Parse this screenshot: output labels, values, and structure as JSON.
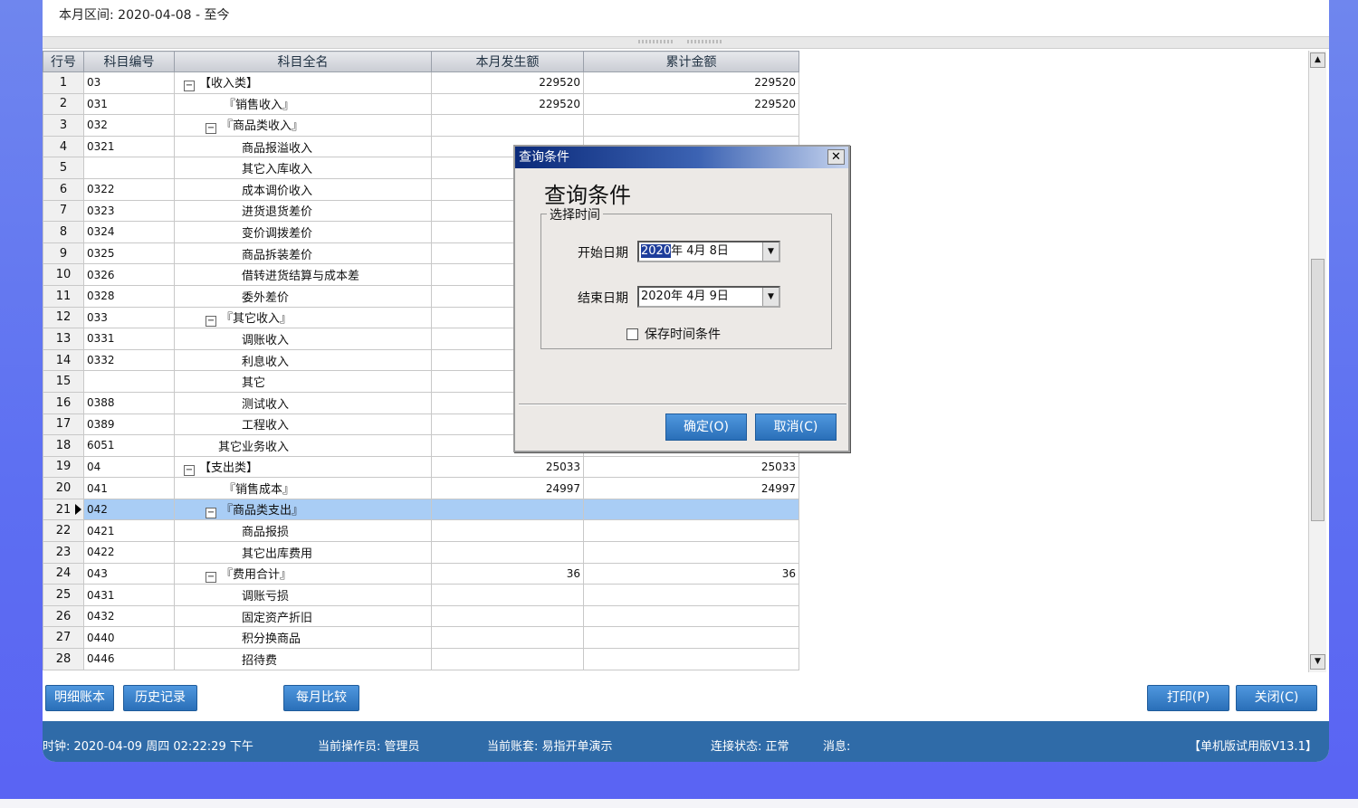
{
  "period": {
    "label": "本月区间: 2020-04-08 - 至今"
  },
  "table": {
    "columns": [
      "行号",
      "科目编号",
      "科目全名",
      "本月发生额",
      "累计金额"
    ],
    "rows": [
      {
        "no": "1",
        "code": "03",
        "name": "【收入类】",
        "toggle": "⊟",
        "month": "229520",
        "total": "229520"
      },
      {
        "no": "2",
        "code": "031",
        "name": "『销售收入』",
        "toggle": "",
        "month": "229520",
        "total": "229520"
      },
      {
        "no": "3",
        "code": "032",
        "name": "『商品类收入』",
        "toggle": "⊟",
        "month": "",
        "total": ""
      },
      {
        "no": "4",
        "code": "0321",
        "name": "商品报溢收入",
        "toggle": "",
        "month": "",
        "total": ""
      },
      {
        "no": "5",
        "code": "",
        "name": "其它入库收入",
        "toggle": "",
        "month": "",
        "total": ""
      },
      {
        "no": "6",
        "code": "0322",
        "name": "成本调价收入",
        "toggle": "",
        "month": "",
        "total": ""
      },
      {
        "no": "7",
        "code": "0323",
        "name": "进货退货差价",
        "toggle": "",
        "month": "",
        "total": ""
      },
      {
        "no": "8",
        "code": "0324",
        "name": "变价调拨差价",
        "toggle": "",
        "month": "",
        "total": ""
      },
      {
        "no": "9",
        "code": "0325",
        "name": "商品拆装差价",
        "toggle": "",
        "month": "",
        "total": ""
      },
      {
        "no": "10",
        "code": "0326",
        "name": "借转进货结算与成本差",
        "toggle": "",
        "month": "",
        "total": ""
      },
      {
        "no": "11",
        "code": "0328",
        "name": "委外差价",
        "toggle": "",
        "month": "",
        "total": ""
      },
      {
        "no": "12",
        "code": "033",
        "name": "『其它收入』",
        "toggle": "⊟",
        "month": "",
        "total": ""
      },
      {
        "no": "13",
        "code": "0331",
        "name": "调账收入",
        "toggle": "",
        "month": "",
        "total": ""
      },
      {
        "no": "14",
        "code": "0332",
        "name": "利息收入",
        "toggle": "",
        "month": "",
        "total": ""
      },
      {
        "no": "15",
        "code": "",
        "name": "其它",
        "toggle": "",
        "month": "",
        "total": ""
      },
      {
        "no": "16",
        "code": "0388",
        "name": "测试收入",
        "toggle": "",
        "month": "",
        "total": ""
      },
      {
        "no": "17",
        "code": "0389",
        "name": "工程收入",
        "toggle": "",
        "month": "",
        "total": ""
      },
      {
        "no": "18",
        "code": "6051",
        "name": "其它业务收入",
        "toggle": "",
        "month": "",
        "total": ""
      },
      {
        "no": "19",
        "code": "04",
        "name": "【支出类】",
        "toggle": "⊟",
        "month": "25033",
        "total": "25033"
      },
      {
        "no": "20",
        "code": "041",
        "name": "『销售成本』",
        "toggle": "",
        "month": "24997",
        "total": "24997"
      },
      {
        "no": "21",
        "code": "042",
        "name": "『商品类支出』",
        "toggle": "⊟",
        "month": "",
        "total": "",
        "selected": true
      },
      {
        "no": "22",
        "code": "0421",
        "name": "商品报损",
        "toggle": "",
        "month": "",
        "total": ""
      },
      {
        "no": "23",
        "code": "0422",
        "name": "其它出库费用",
        "toggle": "",
        "month": "",
        "total": ""
      },
      {
        "no": "24",
        "code": "043",
        "name": "『费用合计』",
        "toggle": "⊟",
        "month": "36",
        "total": "36"
      },
      {
        "no": "25",
        "code": "0431",
        "name": "调账亏损",
        "toggle": "",
        "month": "",
        "total": ""
      },
      {
        "no": "26",
        "code": "0432",
        "name": "固定资产折旧",
        "toggle": "",
        "month": "",
        "total": ""
      },
      {
        "no": "27",
        "code": "0440",
        "name": "积分换商品",
        "toggle": "",
        "month": "",
        "total": ""
      },
      {
        "no": "28",
        "code": "0446",
        "name": "招待费",
        "toggle": "",
        "month": "",
        "total": ""
      }
    ]
  },
  "toolbar": {
    "detail_label": "明细账本",
    "history_label": "历史记录",
    "compare_label": "每月比较",
    "print_label": "打印(P)",
    "close_label": "关闭(C)"
  },
  "status": {
    "time": "时钟: 2020-04-09 周四 02:22:29 下午",
    "operator": "当前操作员: 管理员",
    "account": "当前账套: 易指开单演示",
    "connection": "连接状态: 正常",
    "message": "消息:",
    "version": "【单机版试用版V13.1】"
  },
  "dialog": {
    "title": "查询条件",
    "heading": "查询条件",
    "group_label": "选择时间",
    "start_label": "开始日期",
    "start_year": "2020",
    "start_rest": "年  4月  8日",
    "end_label": "结束日期",
    "end_value": "2020年  4月  9日",
    "save_label": "保存时间条件",
    "ok_label": "确定(O)",
    "cancel_label": "取消(C)"
  },
  "colors": {
    "accent_button": "#2a6fb8",
    "status_bar": "#2f6ba8",
    "selected_row": "#a9cdf5",
    "background": "#5d6ff2"
  }
}
